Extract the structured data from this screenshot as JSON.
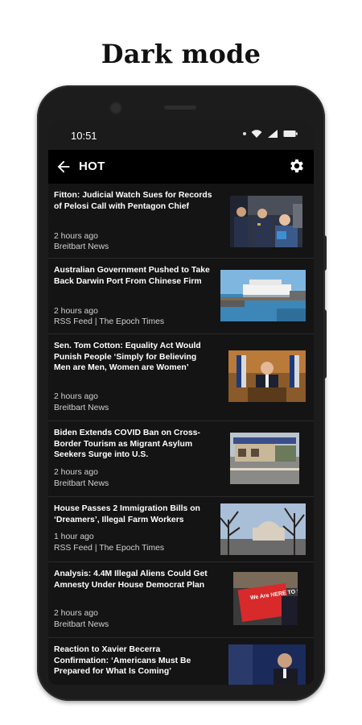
{
  "promo": {
    "title": "Dark mode"
  },
  "status": {
    "time": "10:51"
  },
  "appbar": {
    "title": "HOT"
  },
  "articles": [
    {
      "headline": "Fitton: Judicial Watch Sues for Records of Pelosi Call with Pentagon Chief",
      "time": "2 hours ago",
      "source": "Breitbart News",
      "image": "military-officials-photo"
    },
    {
      "headline": "Australian Government Pushed to Take Back Darwin Port From Chinese Firm",
      "time": "2 hours ago",
      "source": "RSS Feed | The Epoch Times",
      "image": "cruise-ship-port-photo"
    },
    {
      "headline": "Sen. Tom Cotton: Equality Act Would Punish People ‘Simply for Believing Men are Men, Women are Women’",
      "time": "2 hours ago",
      "source": "Breitbart News",
      "image": "senator-podium-photo"
    },
    {
      "headline": "Biden Extends COVID Ban on Cross-Border Tourism as Migrant Asylum Seekers Surge into U.S.",
      "time": "2 hours ago",
      "source": "Breitbart News",
      "image": "border-crossing-photo"
    },
    {
      "headline": "House Passes 2 Immigration Bills on ‘Dreamers’, Illegal Farm Workers",
      "time": "1 hour ago",
      "source": "RSS Feed | The Epoch Times",
      "image": "capitol-trees-photo"
    },
    {
      "headline": "Analysis: 4.4M Illegal Aliens Could Get Amnesty Under House Democrat Plan",
      "time": "2 hours ago",
      "source": "Breitbart News",
      "image": "protest-sign-photo",
      "sign_text": "We Are HERE TO STAY"
    },
    {
      "headline": "Reaction to Xavier Becerra Confirmation: ‘Americans Must Be Prepared for What Is Coming’",
      "time": "",
      "source": "",
      "image": "becerra-photo"
    }
  ],
  "colors": {
    "background": "#141414",
    "appbar": "#000000",
    "text": "#ffffff",
    "muted": "#d0d0d0"
  }
}
